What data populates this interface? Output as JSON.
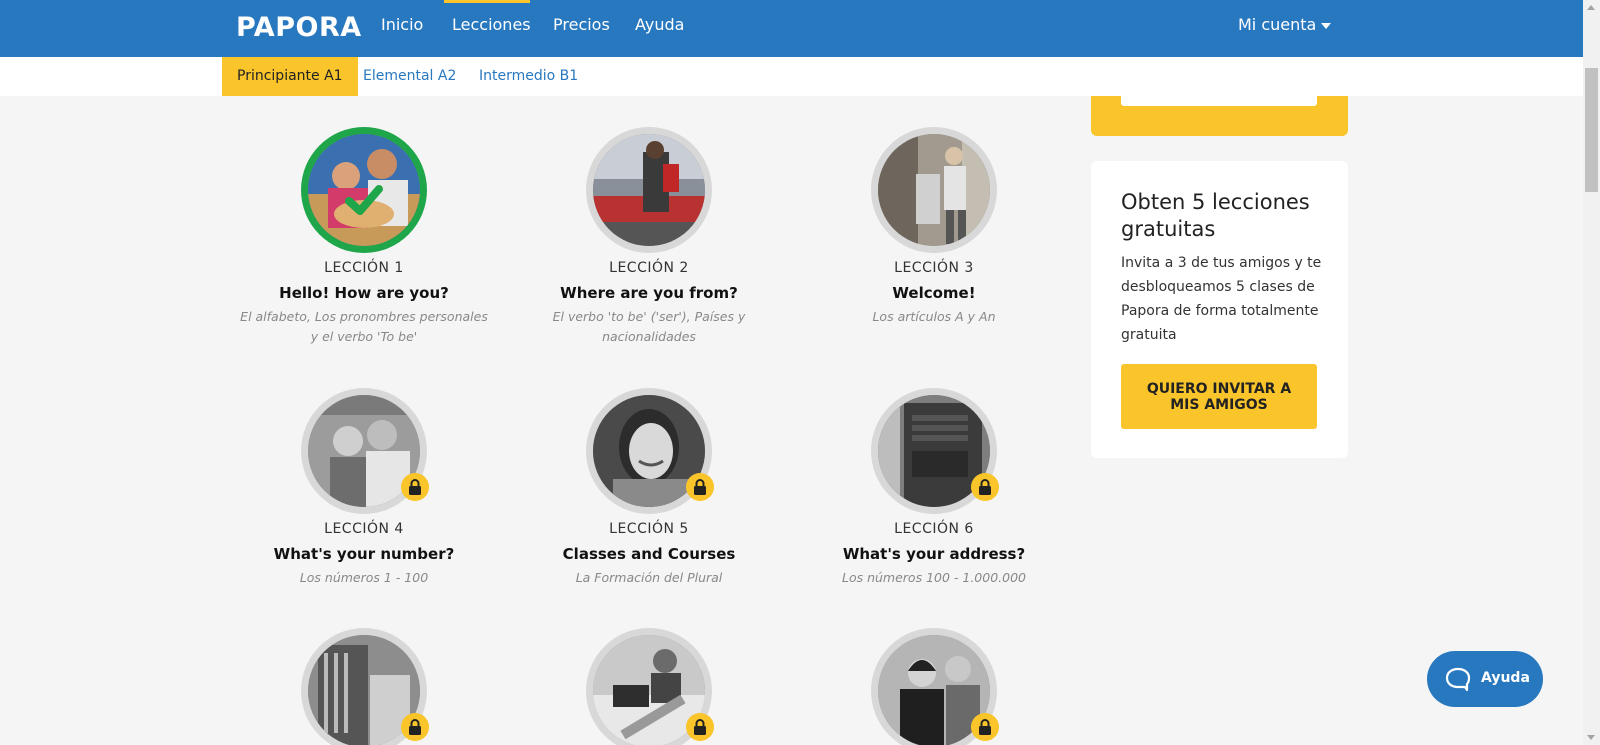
{
  "nav": {
    "logo": "PAPORA",
    "links": [
      "Inicio",
      "Lecciones",
      "Precios",
      "Ayuda"
    ],
    "account": "Mi cuenta",
    "accent_color": "#2878c0"
  },
  "levels": [
    "Principiante A1",
    "Elemental A2",
    "Intermedio B1"
  ],
  "lessons": [
    {
      "num": "LECCIÓN 1",
      "title": "Hello! How are you?",
      "desc": "El alfabeto, Los pronombres personales y el verbo 'To be'",
      "status": "completed"
    },
    {
      "num": "LECCIÓN 2",
      "title": "Where are you from?",
      "desc": "El verbo 'to be' ('ser'), Países y nacionalidades",
      "status": "unlocked"
    },
    {
      "num": "LECCIÓN 3",
      "title": "Welcome!",
      "desc": "Los artículos A y An",
      "status": "unlocked"
    },
    {
      "num": "LECCIÓN 4",
      "title": "What's your number?",
      "desc": "Los números 1 - 100",
      "status": "locked"
    },
    {
      "num": "LECCIÓN 5",
      "title": "Classes and Courses",
      "desc": "La Formación del Plural",
      "status": "locked"
    },
    {
      "num": "LECCIÓN 6",
      "title": "What's your address?",
      "desc": "Los números 100 - 1.000.000",
      "status": "locked"
    }
  ],
  "promo": {
    "title": "Obten 5 lecciones gratuitas",
    "text": "Invita a 3 de tus amigos y te desbloqueamos 5 clases de Papora de forma totalmente gratuita",
    "button": "QUIERO INVITAR A MIS AMIGOS"
  },
  "help": {
    "label": "Ayuda"
  },
  "colors": {
    "primary": "#2878c0",
    "accent": "#f9c52b",
    "success": "#1fa64a"
  },
  "icons": [
    "check-icon",
    "lock-icon",
    "chat-bubble-icon",
    "chevron-down-icon"
  ]
}
